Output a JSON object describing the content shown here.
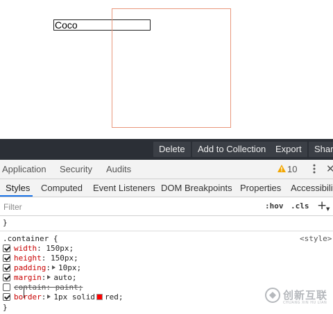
{
  "page": {
    "input_text": "Coco"
  },
  "toolbar": {
    "buttons": [
      "Delete",
      "Add to Collection",
      "Export",
      "Share"
    ]
  },
  "devtools": {
    "tabs": [
      "Application",
      "Security",
      "Audits"
    ],
    "warning_count": "10"
  },
  "subtabs": [
    "Styles",
    "Computed",
    "Event Listeners",
    "DOM Breakpoints",
    "Properties",
    "Accessibility"
  ],
  "filter": {
    "placeholder": "Filter",
    "hov": ":hov",
    "cls": ".cls",
    "add": "+"
  },
  "styles": {
    "prev_brace": "}",
    "selector": ".container {",
    "source": "<style>",
    "declarations": [
      {
        "prop": "width",
        "value": "150px;"
      },
      {
        "prop": "height",
        "value": "150px;"
      },
      {
        "prop": "padding",
        "value": "10px;"
      },
      {
        "prop": "margin",
        "value": "auto;"
      },
      {
        "prop": "contain",
        "value": "paint;"
      },
      {
        "prop": "border",
        "value": "1px solid",
        "value_tail": "red;"
      }
    ],
    "close_brace": "}"
  },
  "colors": {
    "toolbar_bg": "#2b2f36",
    "demo_border": "#e9967a",
    "prop_color": "#c80000",
    "active_tab": "#1a73e8",
    "swatch": "#ff0000"
  },
  "watermark": {
    "text": "创新互联",
    "sub": "CHUANG XIN HU LIAN"
  }
}
